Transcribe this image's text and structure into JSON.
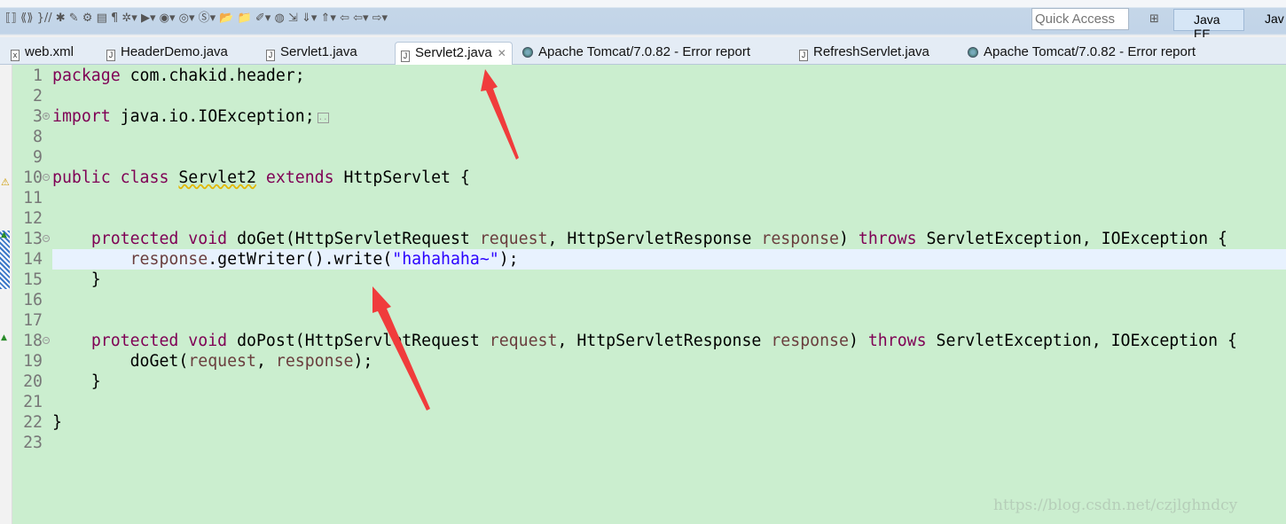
{
  "toolbar": {
    "quick_access_placeholder": "Quick Access",
    "perspective_active": "Java EE",
    "perspective_other": "Jav"
  },
  "tabs": [
    {
      "label": "web.xml",
      "icon": "xml-file-icon",
      "active": false
    },
    {
      "label": "HeaderDemo.java",
      "icon": "java-file-icon",
      "active": false
    },
    {
      "label": "Servlet1.java",
      "icon": "java-file-icon",
      "active": false
    },
    {
      "label": "Servlet2.java",
      "icon": "java-file-icon",
      "active": true
    },
    {
      "label": "Apache Tomcat/7.0.82 - Error report",
      "icon": "globe-icon",
      "active": false
    },
    {
      "label": "RefreshServlet.java",
      "icon": "java-file-icon",
      "active": false
    },
    {
      "label": "Apache Tomcat/7.0.82 - Error report",
      "icon": "globe-icon",
      "active": false
    }
  ],
  "code": [
    {
      "n": "1",
      "t": [
        [
          "kw",
          "package"
        ],
        [
          "pl",
          " com.chakid.header;"
        ]
      ]
    },
    {
      "n": "2",
      "t": []
    },
    {
      "n": "3",
      "fold": "+",
      "t": [
        [
          "kw",
          "import"
        ],
        [
          "pl",
          " java.io.IOException;"
        ]
      ],
      "collapsed": true
    },
    {
      "n": "8",
      "t": []
    },
    {
      "n": "9",
      "t": []
    },
    {
      "n": "10",
      "fold": "-",
      "t": [
        [
          "kw",
          "public class "
        ],
        [
          "warn",
          "Servlet2"
        ],
        [
          "kw",
          " extends"
        ],
        [
          "pl",
          " HttpServlet {"
        ]
      ]
    },
    {
      "n": "11",
      "t": []
    },
    {
      "n": "12",
      "t": []
    },
    {
      "n": "13",
      "fold": "-",
      "t": [
        [
          "pl",
          "    "
        ],
        [
          "kw",
          "protected void"
        ],
        [
          "pl",
          " doGet(HttpServletRequest "
        ],
        [
          "pm",
          "request"
        ],
        [
          "pl",
          ", HttpServletResponse "
        ],
        [
          "pm",
          "response"
        ],
        [
          "pl",
          ") "
        ],
        [
          "kw",
          "throws"
        ],
        [
          "pl",
          " ServletException, IOException {"
        ]
      ]
    },
    {
      "n": "14",
      "current": true,
      "t": [
        [
          "pl",
          "        "
        ],
        [
          "pm",
          "response"
        ],
        [
          "pl",
          ".getWriter().write("
        ],
        [
          "st",
          "\"hahahaha~\""
        ],
        [
          "pl",
          ");"
        ]
      ]
    },
    {
      "n": "15",
      "t": [
        [
          "pl",
          "    }"
        ]
      ]
    },
    {
      "n": "16",
      "t": []
    },
    {
      "n": "17",
      "t": []
    },
    {
      "n": "18",
      "fold": "-",
      "t": [
        [
          "pl",
          "    "
        ],
        [
          "kw",
          "protected void"
        ],
        [
          "pl",
          " doPost(HttpServletRequest "
        ],
        [
          "pm",
          "request"
        ],
        [
          "pl",
          ", HttpServletResponse "
        ],
        [
          "pm",
          "response"
        ],
        [
          "pl",
          ") "
        ],
        [
          "kw",
          "throws"
        ],
        [
          "pl",
          " ServletException, IOException {"
        ]
      ]
    },
    {
      "n": "19",
      "t": [
        [
          "pl",
          "        doGet("
        ],
        [
          "pm",
          "request"
        ],
        [
          "pl",
          ", "
        ],
        [
          "pm",
          "response"
        ],
        [
          "pl",
          ");"
        ]
      ]
    },
    {
      "n": "20",
      "t": [
        [
          "pl",
          "    }"
        ]
      ]
    },
    {
      "n": "21",
      "t": []
    },
    {
      "n": "22",
      "t": [
        [
          "pl",
          "}"
        ]
      ]
    },
    {
      "n": "23",
      "t": []
    }
  ],
  "watermark": "https://blog.csdn.net/czjlghndcy",
  "colors": {
    "keyword": "#7f0055",
    "parameter": "#6a3e3e",
    "string": "#2a00ff",
    "editor_bg": "#cbeecf",
    "annotation_arrow": "#f03c3c"
  }
}
